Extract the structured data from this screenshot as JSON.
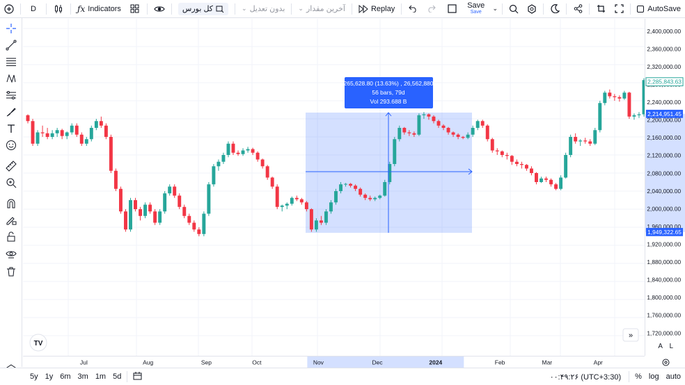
{
  "toolbar": {
    "symbol_interval": "D",
    "indicators_label": "Indicators",
    "market_label": "کل بورس",
    "adjust_label": "بدون تعدیل",
    "last_value_label": "آخرین مقدار",
    "replay_label": "Replay",
    "save_label": "Save",
    "save_sub_label": "Save",
    "autosave_label": "AutoSave"
  },
  "colors": {
    "up": "#26a69a",
    "down": "#f23645",
    "accent": "#2962ff",
    "range_fill": "#2962ff"
  },
  "measure": {
    "line1": "265,628.80 (13.63%) , 26,562,880",
    "line2": "56 bars, 79d",
    "line3": "Vol 293.688 B"
  },
  "price_axis": {
    "ticks": [
      "2,400,000.00",
      "2,360,000.00",
      "2,320,000.00",
      "2,280,000.00",
      "2,240,000.00",
      "2,200,000.00",
      "2,160,000.00",
      "2,120,000.00",
      "2,080,000.00",
      "2,040,000.00",
      "2,000,000.00",
      "1,960,000.00",
      "1,920,000.00",
      "1,880,000.00",
      "1,840,000.00",
      "1,800,000.00",
      "1,760,000.00",
      "1,720,000.00"
    ],
    "last_price_label": "2,285,843.63",
    "measure_top_label": "2,214,951.45",
    "measure_bottom_label": "1,949,322.65"
  },
  "time_axis": {
    "labels": [
      "Jul",
      "Aug",
      "Sep",
      "Oct",
      "Nov",
      "Dec",
      "2024",
      "Feb",
      "Mar",
      "Apr"
    ]
  },
  "bottom": {
    "ranges": [
      "5y",
      "1y",
      "6m",
      "3m",
      "1m",
      "5d"
    ],
    "clock": "۰۰:۴۹:۲۶ (UTC+3:30)",
    "percent": "%",
    "log": "log",
    "auto": "auto"
  },
  "scale_buttons": {
    "a": "A",
    "l": "L"
  },
  "chart_data": {
    "type": "candlestick",
    "xlabels": [
      "Jul",
      "Aug",
      "Sep",
      "Oct",
      "Nov",
      "Dec",
      "2024",
      "Feb",
      "Mar",
      "Apr"
    ],
    "ylim": [
      1700000,
      2420000
    ],
    "ohlc": [
      [
        2208000,
        2210000,
        2190000,
        2195000
      ],
      [
        2195000,
        2200000,
        2140000,
        2145000
      ],
      [
        2145000,
        2175000,
        2140000,
        2170000
      ],
      [
        2170000,
        2185000,
        2160000,
        2168000
      ],
      [
        2168000,
        2180000,
        2155000,
        2160000
      ],
      [
        2160000,
        2175000,
        2155000,
        2168000
      ],
      [
        2168000,
        2180000,
        2160000,
        2175000
      ],
      [
        2175000,
        2178000,
        2155000,
        2162000
      ],
      [
        2162000,
        2172000,
        2155000,
        2170000
      ],
      [
        2170000,
        2190000,
        2165000,
        2185000
      ],
      [
        2185000,
        2190000,
        2160000,
        2165000
      ],
      [
        2165000,
        2170000,
        2140000,
        2145000
      ],
      [
        2145000,
        2160000,
        2140000,
        2155000
      ],
      [
        2155000,
        2185000,
        2150000,
        2180000
      ],
      [
        2180000,
        2200000,
        2175000,
        2195000
      ],
      [
        2195000,
        2205000,
        2180000,
        2185000
      ],
      [
        2185000,
        2190000,
        2155000,
        2160000
      ],
      [
        2160000,
        2165000,
        2080000,
        2085000
      ],
      [
        2085000,
        2090000,
        2040000,
        2045000
      ],
      [
        2045000,
        2050000,
        1990000,
        1995000
      ],
      [
        1995000,
        2000000,
        1950000,
        1955000
      ],
      [
        1955000,
        2025000,
        1950000,
        2020000
      ],
      [
        2020000,
        2025000,
        1995000,
        2000000
      ],
      [
        2000000,
        2005000,
        1975000,
        1985000
      ],
      [
        1985000,
        2015000,
        1980000,
        2010000
      ],
      [
        2010000,
        2015000,
        1990000,
        1995000
      ],
      [
        1995000,
        2000000,
        1965000,
        1970000
      ],
      [
        1970000,
        2000000,
        1965000,
        1995000
      ],
      [
        1995000,
        2040000,
        1990000,
        2035000
      ],
      [
        2035000,
        2055000,
        2030000,
        2050000
      ],
      [
        2050000,
        2055000,
        2025000,
        2030000
      ],
      [
        2030000,
        2035000,
        2000000,
        2005000
      ],
      [
        2005000,
        2010000,
        1980000,
        1985000
      ],
      [
        1985000,
        1990000,
        1965000,
        1970000
      ],
      [
        1970000,
        1975000,
        1950000,
        1955000
      ],
      [
        1955000,
        1960000,
        1940000,
        1945000
      ],
      [
        1945000,
        1995000,
        1940000,
        1990000
      ],
      [
        1990000,
        2060000,
        1985000,
        2055000
      ],
      [
        2055000,
        2100000,
        2050000,
        2095000
      ],
      [
        2095000,
        2110000,
        2085000,
        2105000
      ],
      [
        2105000,
        2125000,
        2100000,
        2120000
      ],
      [
        2120000,
        2150000,
        2115000,
        2145000
      ],
      [
        2145000,
        2150000,
        2120000,
        2125000
      ],
      [
        2125000,
        2130000,
        2118000,
        2122000
      ],
      [
        2122000,
        2135000,
        2118000,
        2130000
      ],
      [
        2130000,
        2138000,
        2125000,
        2133000
      ],
      [
        2133000,
        2136000,
        2120000,
        2125000
      ],
      [
        2125000,
        2128000,
        2105000,
        2110000
      ],
      [
        2110000,
        2112000,
        2090000,
        2095000
      ],
      [
        2095000,
        2098000,
        2065000,
        2070000
      ],
      [
        2070000,
        2072000,
        2045000,
        2050000
      ],
      [
        2050000,
        2055000,
        2000000,
        2005000
      ],
      [
        2005000,
        2010000,
        1995000,
        2008000
      ],
      [
        2008000,
        2015000,
        2000000,
        2012000
      ],
      [
        2012000,
        2028000,
        2008000,
        2025000
      ],
      [
        2025000,
        2030000,
        2018000,
        2022000
      ],
      [
        2022000,
        2025000,
        2010000,
        2015000
      ],
      [
        2015000,
        2018000,
        1995000,
        2000000
      ],
      [
        2000000,
        2002000,
        1950000,
        1955000
      ],
      [
        1955000,
        1980000,
        1950000,
        1975000
      ],
      [
        1975000,
        1985000,
        1965000,
        1970000
      ],
      [
        1970000,
        2000000,
        1965000,
        1995000
      ],
      [
        1995000,
        2020000,
        1990000,
        2015000
      ],
      [
        2015000,
        2045000,
        2010000,
        2040000
      ],
      [
        2040000,
        2060000,
        2035000,
        2055000
      ],
      [
        2055000,
        2058000,
        2050000,
        2056000
      ],
      [
        2056000,
        2058000,
        2048000,
        2052000
      ],
      [
        2052000,
        2055000,
        2040000,
        2045000
      ],
      [
        2045000,
        2048000,
        2028000,
        2032000
      ],
      [
        2032000,
        2035000,
        2020000,
        2025000
      ],
      [
        2025000,
        2030000,
        2018000,
        2022000
      ],
      [
        2022000,
        2028000,
        2018000,
        2025000
      ],
      [
        2025000,
        2032000,
        2022000,
        2030000
      ],
      [
        2030000,
        2065000,
        2028000,
        2060000
      ],
      [
        2060000,
        2105000,
        2055000,
        2100000
      ],
      [
        2100000,
        2160000,
        2095000,
        2155000
      ],
      [
        2155000,
        2185000,
        2150000,
        2180000
      ],
      [
        2180000,
        2182000,
        2165000,
        2170000
      ],
      [
        2170000,
        2175000,
        2162000,
        2168000
      ],
      [
        2168000,
        2172000,
        2160000,
        2165000
      ],
      [
        2165000,
        2212000,
        2162000,
        2208000
      ],
      [
        2208000,
        2215000,
        2200000,
        2210000
      ],
      [
        2210000,
        2212000,
        2198000,
        2205000
      ],
      [
        2205000,
        2208000,
        2190000,
        2195000
      ],
      [
        2195000,
        2198000,
        2180000,
        2185000
      ],
      [
        2185000,
        2188000,
        2175000,
        2180000
      ],
      [
        2180000,
        2182000,
        2165000,
        2170000
      ],
      [
        2170000,
        2172000,
        2160000,
        2165000
      ],
      [
        2165000,
        2168000,
        2155000,
        2160000
      ],
      [
        2160000,
        2162000,
        2155000,
        2158000
      ],
      [
        2158000,
        2170000,
        2155000,
        2165000
      ],
      [
        2165000,
        2185000,
        2160000,
        2180000
      ],
      [
        2180000,
        2198000,
        2175000,
        2195000
      ],
      [
        2195000,
        2198000,
        2180000,
        2185000
      ],
      [
        2185000,
        2188000,
        2150000,
        2155000
      ],
      [
        2155000,
        2158000,
        2125000,
        2130000
      ],
      [
        2130000,
        2135000,
        2120000,
        2128000
      ],
      [
        2128000,
        2130000,
        2115000,
        2120000
      ],
      [
        2120000,
        2125000,
        2110000,
        2118000
      ],
      [
        2118000,
        2120000,
        2098000,
        2105000
      ],
      [
        2105000,
        2110000,
        2095000,
        2100000
      ],
      [
        2100000,
        2105000,
        2090000,
        2098000
      ],
      [
        2098000,
        2100000,
        2085000,
        2090000
      ],
      [
        2090000,
        2095000,
        2075000,
        2080000
      ],
      [
        2080000,
        2082000,
        2055000,
        2060000
      ],
      [
        2060000,
        2072000,
        2058000,
        2068000
      ],
      [
        2068000,
        2072000,
        2060000,
        2065000
      ],
      [
        2065000,
        2068000,
        2050000,
        2055000
      ],
      [
        2055000,
        2058000,
        2042000,
        2045000
      ],
      [
        2045000,
        2075000,
        2042000,
        2070000
      ],
      [
        2070000,
        2125000,
        2068000,
        2120000
      ],
      [
        2120000,
        2165000,
        2115000,
        2160000
      ],
      [
        2160000,
        2168000,
        2145000,
        2150000
      ],
      [
        2150000,
        2155000,
        2140000,
        2152000
      ],
      [
        2152000,
        2158000,
        2145000,
        2150000
      ],
      [
        2150000,
        2155000,
        2140000,
        2145000
      ],
      [
        2145000,
        2180000,
        2142000,
        2175000
      ],
      [
        2175000,
        2240000,
        2170000,
        2235000
      ],
      [
        2235000,
        2262000,
        2230000,
        2258000
      ],
      [
        2258000,
        2265000,
        2245000,
        2250000
      ],
      [
        2250000,
        2255000,
        2240000,
        2248000
      ],
      [
        2248000,
        2252000,
        2238000,
        2245000
      ],
      [
        2245000,
        2262000,
        2242000,
        2258000
      ],
      [
        2258000,
        2260000,
        2200000,
        2205000
      ],
      [
        2205000,
        2212000,
        2198000,
        2208000
      ],
      [
        2208000,
        2215000,
        2202000,
        2210000
      ],
      [
        2210000,
        2290000,
        2205000,
        2285843
      ]
    ]
  }
}
